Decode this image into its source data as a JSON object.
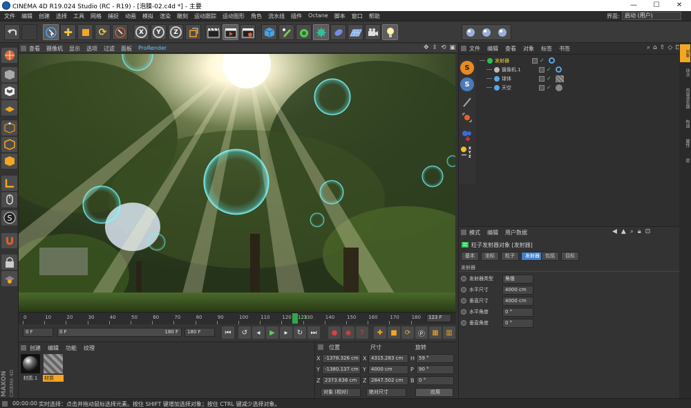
{
  "window": {
    "title": "CINEMA 4D R19.024 Studio (RC - R19) - [泡膜-02.c4d *] - 主要",
    "controls": {
      "minimize": "—",
      "maximize": "☐",
      "close": "✕"
    }
  },
  "menubar": {
    "items": [
      "文件",
      "编辑",
      "创建",
      "选择",
      "工具",
      "网格",
      "捕捉",
      "动画",
      "模拟",
      "渲染",
      "雕刻",
      "运动跟踪",
      "运动图形",
      "角色",
      "流水线",
      "插件",
      "Octane",
      "脚本",
      "窗口",
      "帮助"
    ],
    "interface_label": "界面:",
    "interface_value": "启动 (用户)"
  },
  "toolbar": {
    "axis_x": "X",
    "axis_y": "Y",
    "axis_z": "Z"
  },
  "viewport": {
    "menu": [
      "查看",
      "摄像机",
      "显示",
      "选项",
      "过滤",
      "面板"
    ],
    "prorender": "ProRender"
  },
  "timeline": {
    "ticks": [
      "0",
      "10",
      "20",
      "30",
      "40",
      "50",
      "60",
      "70",
      "80",
      "90",
      "100",
      "110",
      "120",
      "130",
      "140",
      "150",
      "160",
      "170",
      "180"
    ],
    "current_frame_label": "123",
    "frame_display": "123 F"
  },
  "transport": {
    "start": "0 F",
    "range_start": "0 F",
    "range_end": "180 F",
    "end": "180 F"
  },
  "material_panel": {
    "tabs": [
      "创建",
      "编辑",
      "功能",
      "纹理"
    ],
    "materials": [
      {
        "name": "材质.1"
      },
      {
        "name": "材质"
      }
    ],
    "logo_maxon": "MAXON",
    "logo_c4d": "CINEMA 4D"
  },
  "coord_panel": {
    "headers": [
      "位置",
      "尺寸",
      "旋转"
    ],
    "rows": [
      {
        "axis": "X",
        "pos": "-1378.326 cm",
        "size_axis": "X",
        "size": "4315.283 cm",
        "rot_axis": "H",
        "rot": "59 °"
      },
      {
        "axis": "Y",
        "pos": "-1380.137 cm",
        "size_axis": "Y",
        "size": "4000 cm",
        "rot_axis": "P",
        "rot": "90 °"
      },
      {
        "axis": "Z",
        "pos": "2373.636 cm",
        "size_axis": "Z",
        "size": "2847.502 cm",
        "rot_axis": "B",
        "rot": "0 °"
      }
    ],
    "mode1": "对象 (相对)",
    "mode2": "绝对尺寸",
    "apply": "应用"
  },
  "object_manager": {
    "menu": [
      "文件",
      "编辑",
      "查看",
      "对象",
      "标签",
      "书签"
    ],
    "objects": [
      {
        "name": "发射器",
        "color": "#f0d040"
      },
      {
        "name": "摄像机.1",
        "color": "#cccccc"
      },
      {
        "name": "球体",
        "color": "#cccccc"
      },
      {
        "name": "天空",
        "color": "#cccccc"
      }
    ]
  },
  "attribute_manager": {
    "menu": [
      "模式",
      "编辑",
      "用户数据"
    ],
    "object_title": "粒子发射器对象 [发射器]",
    "tabs": [
      "基本",
      "坐标",
      "粒子",
      "发射器",
      "包括",
      "目标"
    ],
    "active_tab": "发射器",
    "section": "发射器",
    "params": [
      {
        "label": "发射器类型",
        "value": "角锥"
      },
      {
        "label": "水平尺寸",
        "value": "4000 cm"
      },
      {
        "label": "垂直尺寸",
        "value": "4000 cm"
      },
      {
        "label": "水平角度",
        "value": "0 °"
      },
      {
        "label": "垂直角度",
        "value": "0 °"
      }
    ]
  },
  "right_tabs": [
    "对象",
    "场次",
    "内容浏览器",
    "构造",
    "属性",
    "层"
  ],
  "statusbar": {
    "time": "00:00:00",
    "message": "实时选择：点击并拖动鼠标选择元素。按住 SHIFT 键增加选择对象；按住 CTRL 键减少选择对象。"
  }
}
